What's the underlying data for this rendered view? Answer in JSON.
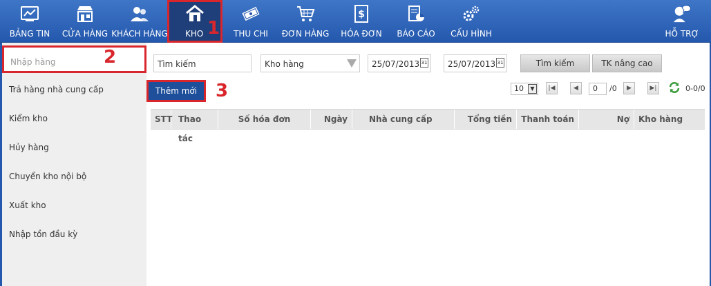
{
  "nav": {
    "items": [
      {
        "label": "BẢNG TIN",
        "icon": "dashboard-icon"
      },
      {
        "label": "CỬA HÀNG",
        "icon": "store-icon"
      },
      {
        "label": "KHÁCH HÀNG",
        "icon": "customers-icon"
      },
      {
        "label": "KHO",
        "icon": "warehouse-icon"
      },
      {
        "label": "THU CHI",
        "icon": "money-icon"
      },
      {
        "label": "ĐƠN HÀNG",
        "icon": "cart-icon"
      },
      {
        "label": "HÓA ĐƠN",
        "icon": "invoice-icon"
      },
      {
        "label": "BÁO CÁO",
        "icon": "report-icon"
      },
      {
        "label": "CẤU HÌNH",
        "icon": "settings-icon"
      },
      {
        "label": "HỖ TRỢ",
        "icon": "support-icon"
      }
    ],
    "active": "KHO"
  },
  "callouts": {
    "one": "1",
    "two": "2",
    "three": "3"
  },
  "sidebar": {
    "items": [
      {
        "label": "Nhập hàng"
      },
      {
        "label": "Trả hàng nhà cung cấp"
      },
      {
        "label": "Kiểm kho"
      },
      {
        "label": "Hủy hàng"
      },
      {
        "label": "Chuyển kho nội bộ"
      },
      {
        "label": "Xuất kho"
      },
      {
        "label": "Nhập tồn đầu kỳ"
      }
    ]
  },
  "filters": {
    "search_value": "Tìm kiếm",
    "warehouse_value": "Kho hàng",
    "date_from": "25/07/2013",
    "date_to": "25/07/2013",
    "search_button": "Tìm kiếm",
    "advanced_button": "TK nâng cao",
    "cal_label": "31"
  },
  "actions": {
    "add_button": "Thêm mới"
  },
  "pager": {
    "page_size": "10",
    "page": "0",
    "total_pages": "/0",
    "range": "0-0/0"
  },
  "table": {
    "columns": [
      "STT",
      "Thao tác",
      "Số hóa đơn",
      "Ngày",
      "Nhà cung cấp",
      "Tổng tiền",
      "Thanh toán",
      "Nợ",
      "Kho hàng"
    ]
  }
}
